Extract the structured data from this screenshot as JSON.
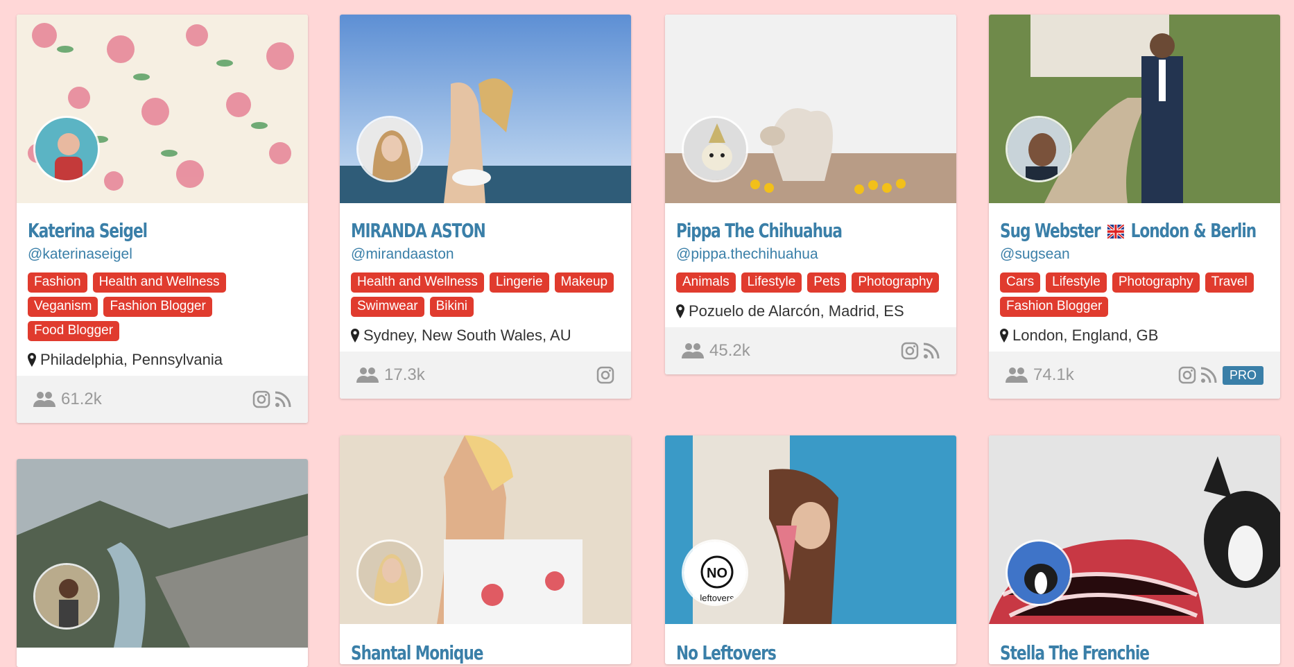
{
  "cards": [
    {
      "name": "Katerina Seigel",
      "handle": "@katerinaseigel",
      "tags": [
        "Fashion",
        "Health and Wellness",
        "Veganism",
        "Fashion Blogger",
        "Food Blogger"
      ],
      "location": "Philadelphia, Pennsylvania",
      "followers": "61.2k",
      "icons": [
        "instagram-icon",
        "rss-icon"
      ]
    },
    {
      "name": "MIRANDA ASTON",
      "handle": "@mirandaaston",
      "tags": [
        "Health and Wellness",
        "Lingerie",
        "Makeup",
        "Swimwear",
        "Bikini"
      ],
      "location": "Sydney, New South Wales, AU",
      "followers": "17.3k",
      "icons": [
        "instagram-icon"
      ]
    },
    {
      "name": "Pippa The Chihuahua",
      "handle": "@pippa.thechihuahua",
      "tags": [
        "Animals",
        "Lifestyle",
        "Pets",
        "Photography"
      ],
      "location": "Pozuelo de Alarcón, Madrid, ES",
      "followers": "45.2k",
      "icons": [
        "instagram-icon",
        "rss-icon"
      ]
    },
    {
      "name_part1": "Sug Webster",
      "name_part2": "London & Berlin",
      "handle": "@sugsean",
      "tags": [
        "Cars",
        "Lifestyle",
        "Photography",
        "Travel",
        "Fashion Blogger"
      ],
      "location": "London, England, GB",
      "followers": "74.1k",
      "icons": [
        "instagram-icon",
        "rss-icon"
      ],
      "badge": "PRO"
    },
    {
      "name": ""
    },
    {
      "name": "Shantal Monique"
    },
    {
      "name": "No Leftovers",
      "avatar_text_1": "NO",
      "avatar_text_2": "leftovers"
    },
    {
      "name": "Stella The Frenchie"
    }
  ],
  "colors": {
    "background": "#ffd7d7",
    "accent": "#3a7fa8",
    "tag": "#e03b2e",
    "footer": "#f2f2f2"
  }
}
